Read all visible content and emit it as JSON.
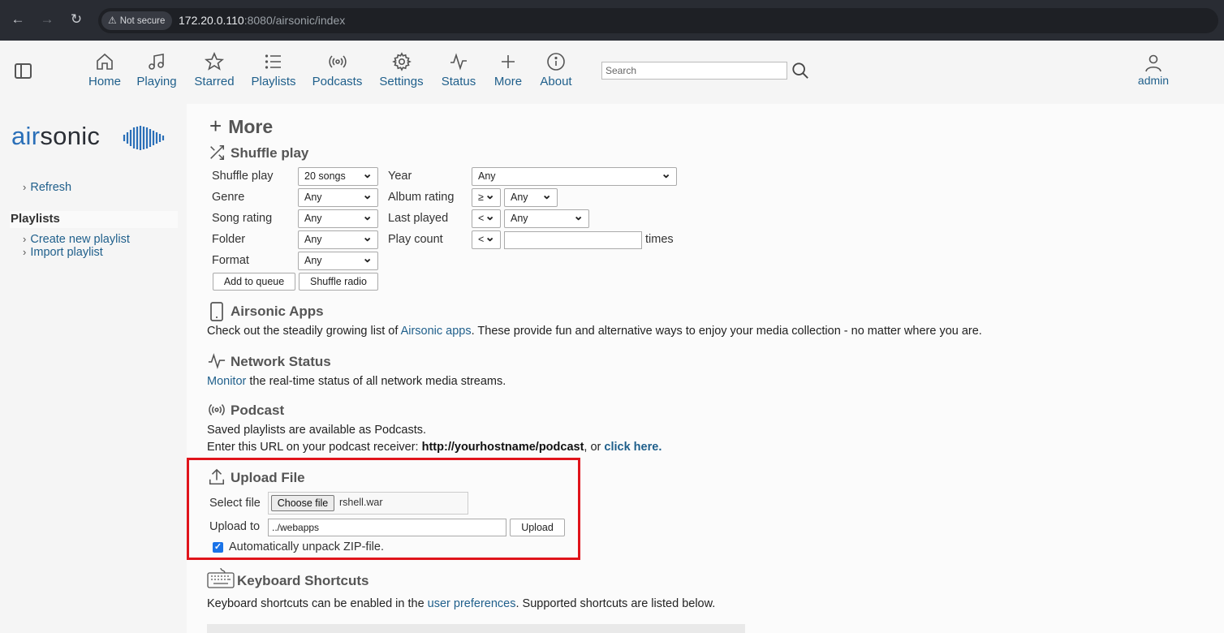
{
  "browser": {
    "security_label": "Not secure",
    "url_host": "172.20.0.110",
    "url_rest": ":8080/airsonic/index"
  },
  "nav": {
    "items": [
      {
        "label": "Home",
        "icon": "home-icon"
      },
      {
        "label": "Playing",
        "icon": "music-note-icon"
      },
      {
        "label": "Starred",
        "icon": "star-icon"
      },
      {
        "label": "Playlists",
        "icon": "list-icon"
      },
      {
        "label": "Podcasts",
        "icon": "podcast-icon"
      },
      {
        "label": "Settings",
        "icon": "gear-icon"
      },
      {
        "label": "Status",
        "icon": "pulse-icon"
      },
      {
        "label": "More",
        "icon": "plus-icon"
      },
      {
        "label": "About",
        "icon": "info-icon"
      }
    ],
    "search_placeholder": "Search",
    "user": "admin"
  },
  "left": {
    "logo_air": "air",
    "logo_sonic": "sonic",
    "refresh": "Refresh",
    "playlists_heading": "Playlists",
    "create_playlist": "Create new playlist",
    "import_playlist": "Import playlist"
  },
  "main": {
    "title": "More",
    "shuffle": {
      "heading": "Shuffle play",
      "labels": {
        "shuffle_play": "Shuffle play",
        "genre": "Genre",
        "song_rating": "Song rating",
        "folder": "Folder",
        "format": "Format",
        "year": "Year",
        "album_rating": "Album rating",
        "last_played": "Last played",
        "play_count": "Play count",
        "times": "times"
      },
      "values": {
        "shuffle_play": "20 songs",
        "genre": "Any",
        "song_rating": "Any",
        "folder": "Any",
        "format": "Any",
        "year": "Any",
        "album_rating_op": "≥",
        "album_rating": "Any",
        "last_played_op": "<",
        "last_played": "Any",
        "play_count_op": "<",
        "play_count": ""
      },
      "add_to_queue": "Add to queue",
      "shuffle_radio": "Shuffle radio"
    },
    "apps": {
      "heading": "Airsonic Apps",
      "text_before": "Check out the steadily growing list of ",
      "link": "Airsonic apps",
      "text_after": ". These provide fun and alternative ways to enjoy your media collection - no matter where you are."
    },
    "network": {
      "heading": "Network Status",
      "link": "Monitor",
      "text": " the real-time status of all network media streams."
    },
    "podcast": {
      "heading": "Podcast",
      "line1": "Saved playlists are available as Podcasts.",
      "line2_before": "Enter this URL on your podcast receiver: ",
      "url": "http://yourhostname/podcast",
      "line2_mid": ", or ",
      "click_here": "click here."
    },
    "upload": {
      "heading": "Upload File",
      "select_label": "Select file",
      "choose_button": "Choose file",
      "file_name": "rshell.war",
      "upload_to_label": "Upload to",
      "upload_to_value": "../webapps",
      "upload_button": "Upload",
      "unpack_label": "Automatically unpack ZIP-file.",
      "unpack_checked": true
    },
    "keyboard": {
      "heading": "Keyboard Shortcuts",
      "text_before": "Keyboard shortcuts can be enabled in the ",
      "link": "user preferences",
      "text_after": ". Supported shortcuts are listed below."
    }
  },
  "colors": {
    "highlight_box": "#e0141b",
    "link": "#1f5f8b",
    "brand_blue": "#2a6fb8"
  }
}
